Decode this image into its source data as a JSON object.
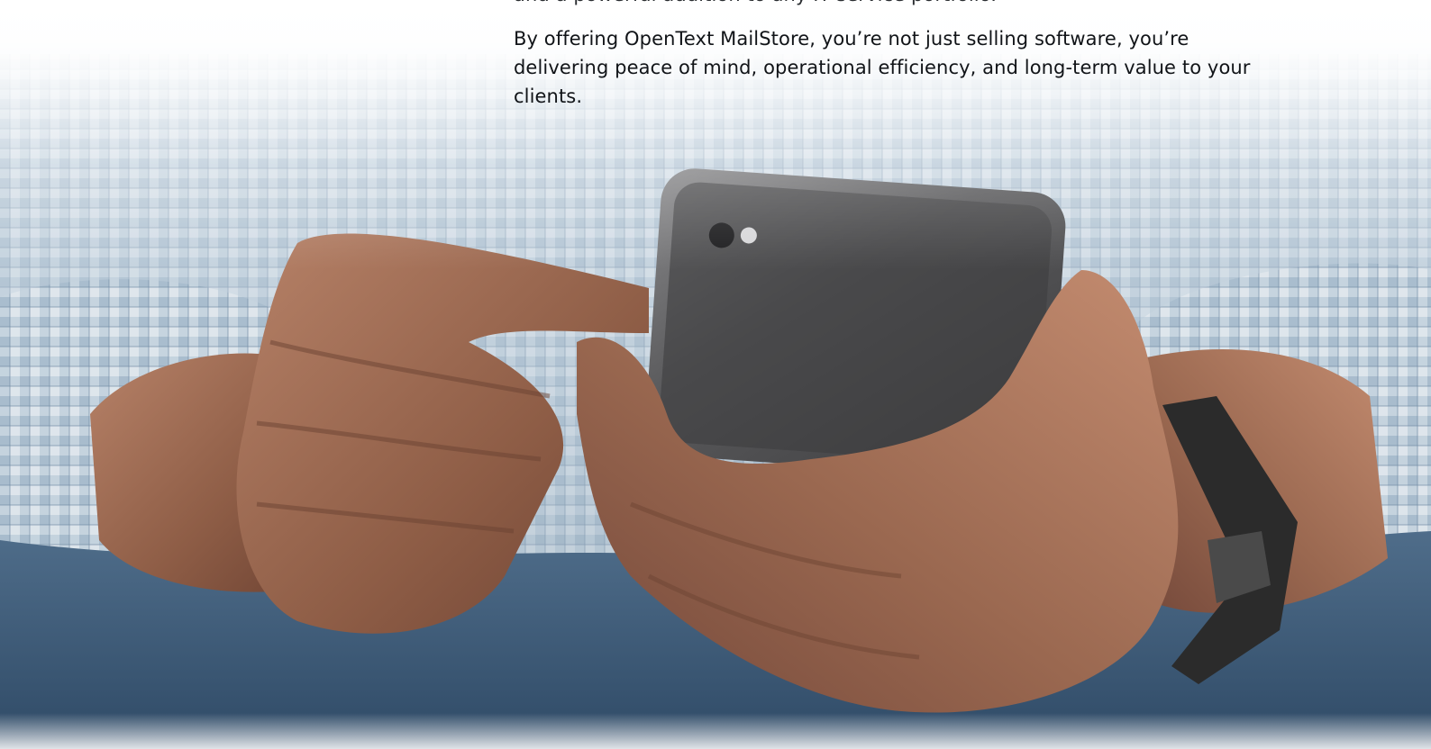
{
  "article": {
    "cut_off_line": "and a powerful addition to any IT service portfolio.",
    "closing_paragraph": "By offering OpenText MailStore, you’re not just selling software, you’re delivering peace of mind, operational efficiency, and long-term value to your clients."
  },
  "hero_image": {
    "subject": "hands-holding-smartphone-photo",
    "colors": {
      "shirt": "#b9c7d3",
      "skin": "#9c6d55",
      "phone": "#4a4a4c",
      "jeans": "#3d5a78",
      "watch": "#2b2b2b"
    }
  }
}
